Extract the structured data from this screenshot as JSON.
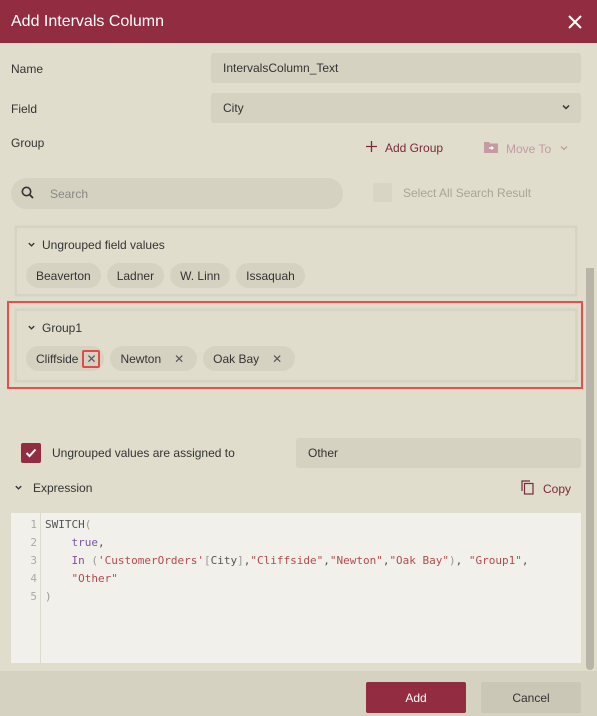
{
  "dialog": {
    "title": "Add Intervals Column",
    "close_icon": "close-icon"
  },
  "form": {
    "name_label": "Name",
    "name_value": "IntervalsColumn_Text",
    "field_label": "Field",
    "field_value": "City",
    "group_label": "Group"
  },
  "toolbar": {
    "add_group_label": "Add Group",
    "move_to_label": "Move To"
  },
  "search": {
    "placeholder": "Search",
    "select_all_label": "Select All Search Result"
  },
  "ungrouped": {
    "title": "Ungrouped field values",
    "values": [
      "Beaverton",
      "Ladner",
      "W. Linn",
      "Issaquah"
    ]
  },
  "groups": [
    {
      "title": "Group1",
      "values": [
        "Cliffside",
        "Newton",
        "Oak Bay"
      ]
    }
  ],
  "ungrouped_assign": {
    "checked": true,
    "label": "Ungrouped values are assigned to",
    "value": "Other"
  },
  "expression": {
    "title": "Expression",
    "copy_label": "Copy",
    "line_numbers": [
      "1",
      "2",
      "3",
      "4",
      "5"
    ],
    "lines": [
      "SWITCH(",
      "    true,",
      "    In ('CustomerOrders'[City],\"Cliffside\",\"Newton\",\"Oak Bay\"), \"Group1\",",
      "    \"Other\"",
      ")"
    ]
  },
  "footer": {
    "add_label": "Add",
    "cancel_label": "Cancel"
  },
  "colors": {
    "accent": "#922c41",
    "background": "#e0ddcd",
    "highlight": "#e25050"
  }
}
